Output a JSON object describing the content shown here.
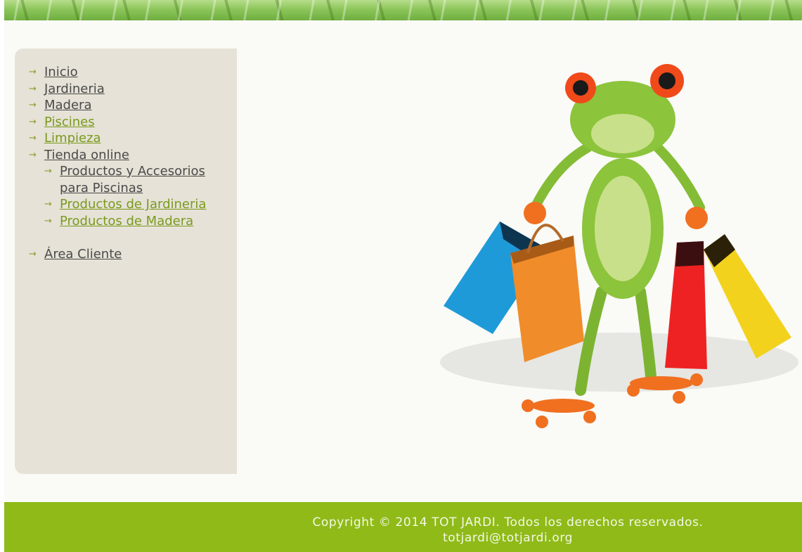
{
  "menu": {
    "items": [
      {
        "label": "Inicio"
      },
      {
        "label": "Jardineria"
      },
      {
        "label": "Madera"
      },
      {
        "label": "Piscines"
      },
      {
        "label": "Limpieza"
      },
      {
        "label": "Tienda online"
      }
    ],
    "sub_items": [
      {
        "label": "Productos y Accesorios para Piscinas"
      },
      {
        "label": "Productos de Jardineria"
      },
      {
        "label": "Productos de Madera"
      }
    ],
    "client_area": "Área Cliente",
    "arrow_icon": "→"
  },
  "hero": {
    "image": "frog-with-shopping-bags-illustration"
  },
  "footer": {
    "copyright": "Copyright © 2014 TOT JARDI. Todos los derechos reservados.",
    "email": "totjardi@totjardi.org"
  },
  "colors": {
    "footer_bg": "#8fba18",
    "sidebar_bg": "#e6e2d7",
    "link_green": "#7a9a1d",
    "link_gray": "#4a4a4a"
  }
}
